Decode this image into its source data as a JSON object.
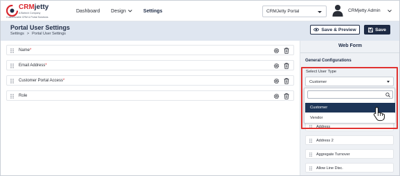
{
  "brand": {
    "name_prefix": "CRM",
    "name_suffix": "jetty",
    "sub": "A Biztech Company",
    "tagline": "Customizable CRM & Portal Solutions"
  },
  "nav": {
    "items": [
      {
        "label": "Dashboard",
        "has_chevron": false,
        "active": false
      },
      {
        "label": "Design",
        "has_chevron": true,
        "active": false
      },
      {
        "label": "Settings",
        "has_chevron": false,
        "active": true
      }
    ]
  },
  "portal_select": {
    "value": "CRMJetty Portal"
  },
  "user": {
    "name": "CRMjetty Admin"
  },
  "header": {
    "title": "Portal User Settings",
    "breadcrumb": [
      "Settings",
      "Portal User Settings"
    ],
    "breadcrumb_sep": ">",
    "preview_label": "Save & Preview",
    "save_label": "Save"
  },
  "fields": [
    {
      "label": "Name",
      "required": "*"
    },
    {
      "label": "Email Address",
      "required": "*"
    },
    {
      "label": "Customer Portal Access",
      "required": "*"
    },
    {
      "label": "Role",
      "required": ""
    }
  ],
  "panel": {
    "title": "Web Form",
    "section": "General Configurations",
    "user_type_label": "Select User Type",
    "user_type_value": "Customer",
    "search_placeholder": "",
    "options": [
      {
        "label": "Customer",
        "selected": true
      },
      {
        "label": "Vendor",
        "selected": false
      }
    ],
    "cards": [
      "Address",
      "Address 2",
      "Aggregate Turnover",
      "Allow Line Disc."
    ]
  },
  "colors": {
    "primary": "#1d2a44",
    "accent_red": "#e0312f",
    "header_band": "#dfe6f0",
    "panel_bg": "#eef1f5",
    "selected_option": "#1d3557"
  }
}
